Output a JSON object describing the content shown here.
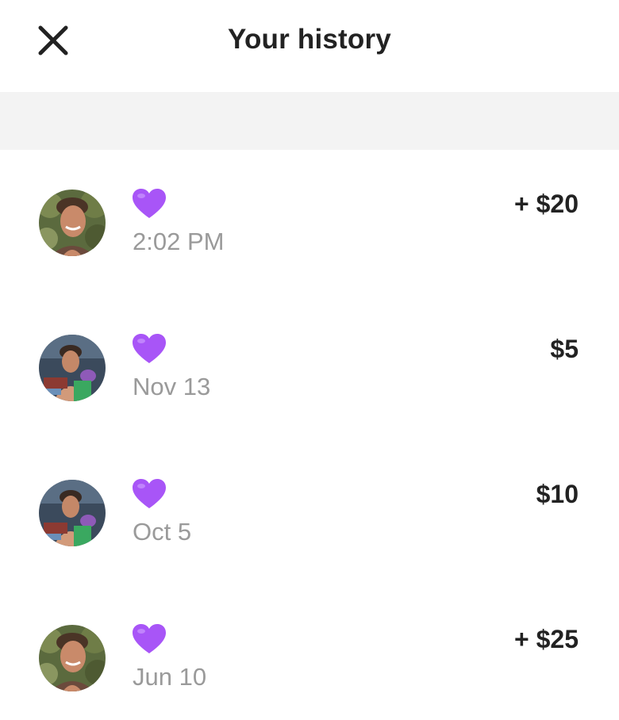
{
  "header": {
    "title": "Your history"
  },
  "icons": {
    "close": "close-icon",
    "heart": "purple-heart-icon"
  },
  "colors": {
    "heart": "#a855f7",
    "date_text": "#9a9a9a",
    "amount_text": "#222222",
    "band": "#f3f3f3"
  },
  "transactions": [
    {
      "date": "2:02 PM",
      "amount": "+ $20",
      "avatar": "profile-photo-1"
    },
    {
      "date": "Nov 13",
      "amount": "$5",
      "avatar": "profile-photo-2"
    },
    {
      "date": "Oct 5",
      "amount": "$10",
      "avatar": "profile-photo-2"
    },
    {
      "date": "Jun 10",
      "amount": "+ $25",
      "avatar": "profile-photo-1"
    }
  ]
}
